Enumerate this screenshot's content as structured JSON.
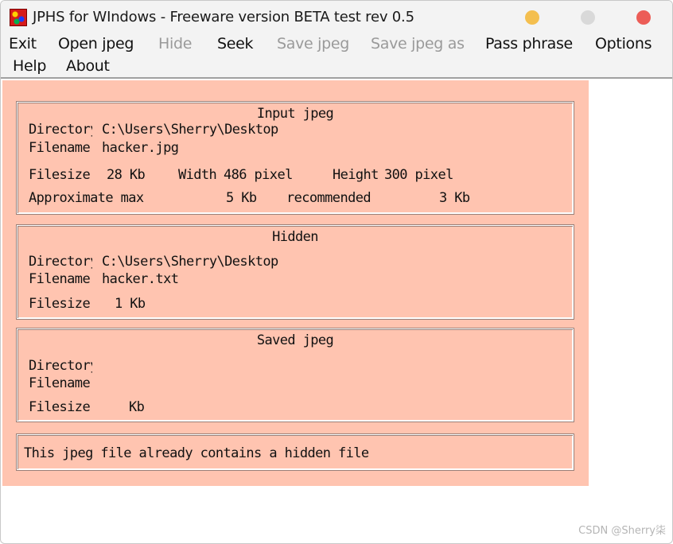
{
  "window": {
    "title": "JPHS for WIndows - Freeware version BETA test rev 0.5"
  },
  "menu": {
    "exit": "Exit",
    "open_jpeg": "Open jpeg",
    "hide": "Hide",
    "seek": "Seek",
    "save_jpeg": "Save jpeg",
    "save_jpeg_as": "Save jpeg as",
    "pass_phrase": "Pass phrase",
    "options": "Options",
    "help": "Help",
    "about": "About"
  },
  "input_jpeg": {
    "title": "Input jpeg",
    "directory_label": "Directory",
    "directory_value": "C:\\Users\\Sherry\\Desktop",
    "filename_label": "Filename",
    "filename_value": "hacker.jpg",
    "filesize_label": "Filesize",
    "filesize_value": "28 Kb",
    "width_label": "Width",
    "width_value": "486 pixel",
    "height_label": "Height",
    "height_value": "300 pixel",
    "approx_label": "Approximate max",
    "approx_value": "5 Kb",
    "recommended_label": "recommended",
    "recommended_value": "3 Kb"
  },
  "hidden": {
    "title": "Hidden",
    "directory_label": "Directory",
    "directory_value": "C:\\Users\\Sherry\\Desktop",
    "filename_label": "Filename",
    "filename_value": "hacker.txt",
    "filesize_label": "Filesize",
    "filesize_value": "1 Kb"
  },
  "saved_jpeg": {
    "title": "Saved jpeg",
    "directory_label": "Directory",
    "filename_label": "Filename",
    "filesize_label": "Filesize",
    "filesize_unit": "Kb"
  },
  "status": {
    "message": "This jpeg file already contains a hidden file"
  },
  "watermark": "CSDN @Sherry柒",
  "colors": {
    "client_background": "#ffc4b0",
    "title_background": "#f3f3f3",
    "minimize": "#f4bf4f",
    "maximize": "#d9d9d9",
    "close": "#ec5d57"
  },
  "icons": {
    "app": "jphs-app-icon"
  }
}
